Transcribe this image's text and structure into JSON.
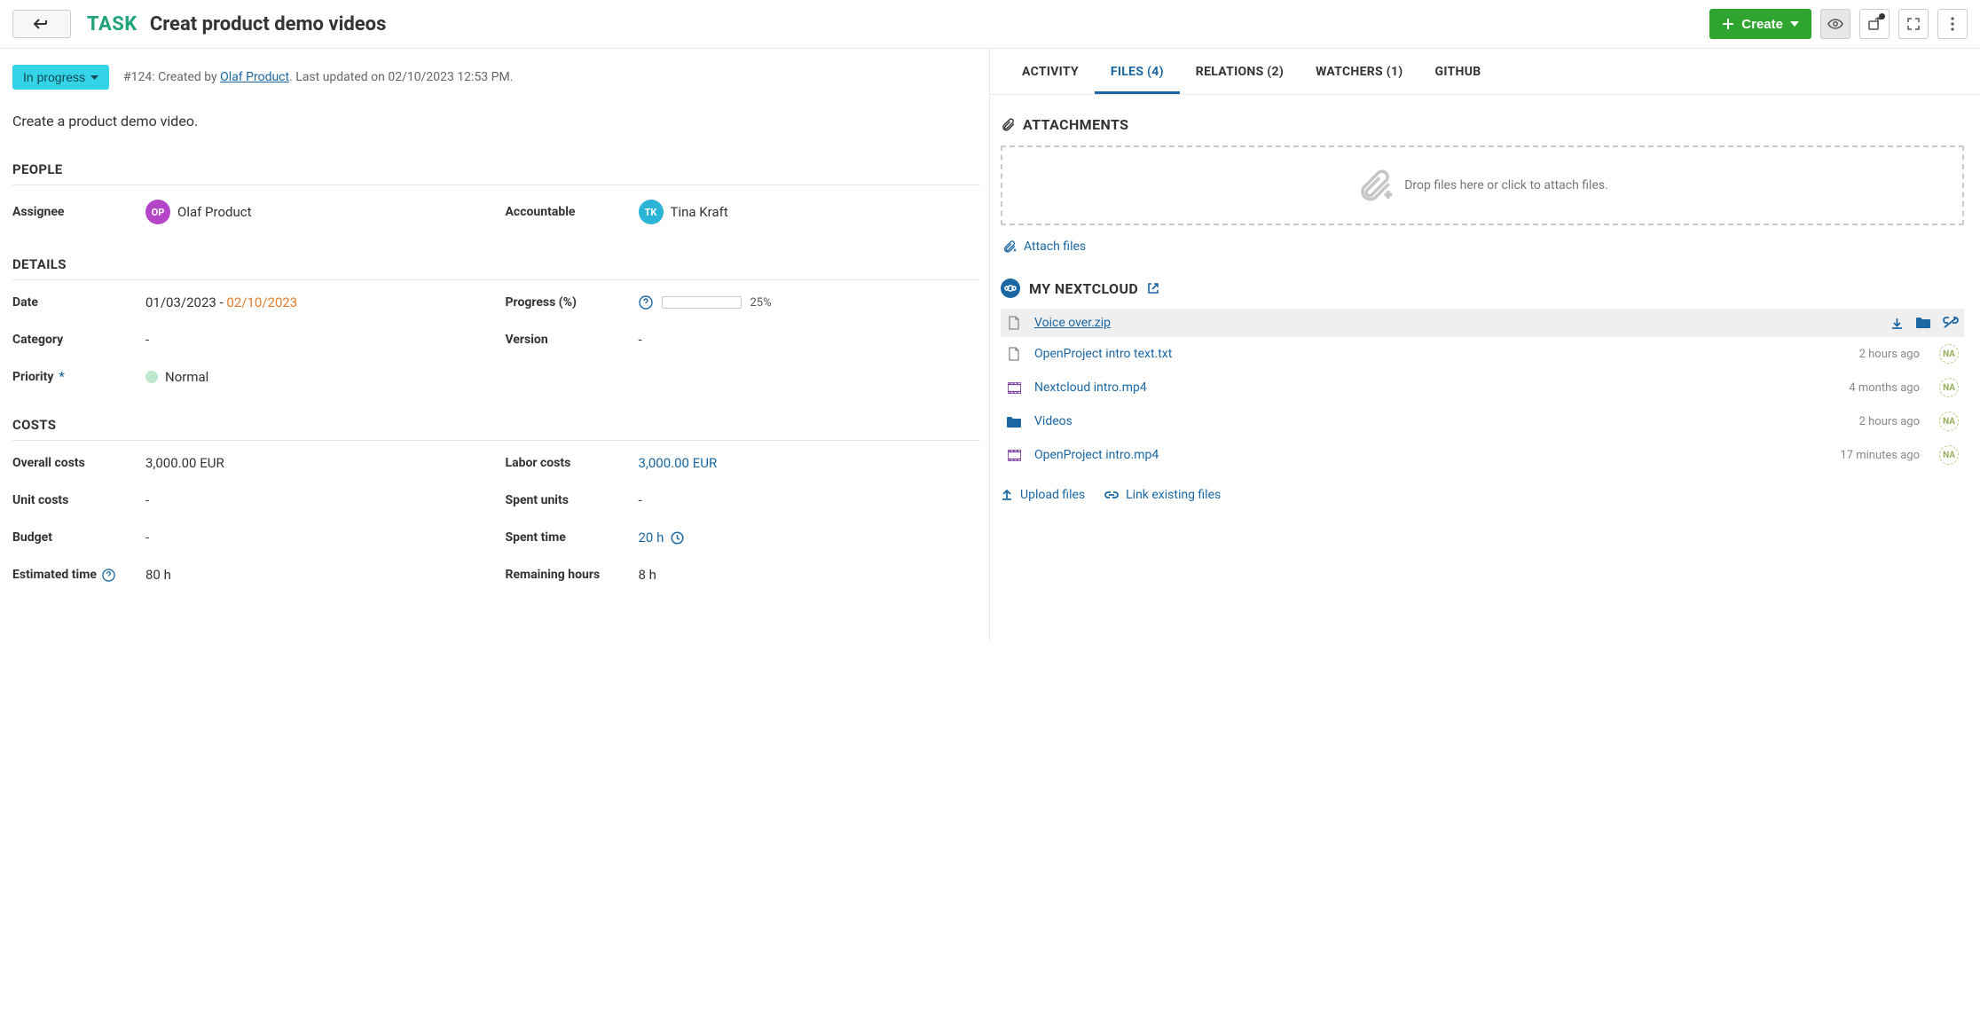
{
  "header": {
    "task_label": "TASK",
    "title": "Creat product demo videos",
    "create_label": "Create"
  },
  "status": {
    "state": "In progress",
    "meta_prefix": "#124: Created by ",
    "author": "Olaf Product",
    "meta_suffix": ". Last updated on 02/10/2023 12:53 PM."
  },
  "description": "Create a product demo video.",
  "people": {
    "heading": "PEOPLE",
    "assignee_label": "Assignee",
    "assignee_initials": "OP",
    "assignee_name": "Olaf Product",
    "accountable_label": "Accountable",
    "accountable_initials": "TK",
    "accountable_name": "Tina Kraft"
  },
  "details": {
    "heading": "DETAILS",
    "date_label": "Date",
    "date_start": "01/03/2023",
    "date_sep": " - ",
    "date_end": "02/10/2023",
    "progress_label": "Progress (%)",
    "progress_pct_num": 25,
    "progress_pct_text": "25%",
    "category_label": "Category",
    "category_value": "-",
    "version_label": "Version",
    "version_value": "-",
    "priority_label": "Priority",
    "priority_value": "Normal"
  },
  "costs": {
    "heading": "COSTS",
    "overall_label": "Overall costs",
    "overall_value": "3,000.00 EUR",
    "labor_label": "Labor costs",
    "labor_value": "3,000.00 EUR",
    "unit_label": "Unit costs",
    "unit_value": "-",
    "spent_units_label": "Spent units",
    "spent_units_value": "-",
    "budget_label": "Budget",
    "budget_value": "-",
    "spent_time_label": "Spent time",
    "spent_time_value": "20 h",
    "estimated_label": "Estimated time",
    "estimated_value": "80 h",
    "remaining_label": "Remaining hours",
    "remaining_value": "8 h"
  },
  "tabs": {
    "activity": "ACTIVITY",
    "files": "FILES (4)",
    "relations": "RELATIONS (2)",
    "watchers": "WATCHERS (1)",
    "github": "GITHUB"
  },
  "attachments": {
    "heading": "ATTACHMENTS",
    "drop_text": "Drop files here or click to attach files.",
    "attach_link": "Attach files"
  },
  "nextcloud": {
    "heading": "MY NEXTCLOUD",
    "files": [
      {
        "name": "Voice over.zip",
        "ago": "",
        "icon": "file",
        "highlight": true
      },
      {
        "name": "OpenProject intro text.txt",
        "ago": "2 hours ago",
        "icon": "file",
        "highlight": false
      },
      {
        "name": "Nextcloud intro.mp4",
        "ago": "4 months ago",
        "icon": "video",
        "highlight": false
      },
      {
        "name": "Videos",
        "ago": "2 hours ago",
        "icon": "folder",
        "highlight": false
      },
      {
        "name": "OpenProject intro.mp4",
        "ago": "17 minutes ago",
        "icon": "video",
        "highlight": false
      }
    ],
    "upload_link": "Upload files",
    "link_existing": "Link existing files",
    "na_initials": "NA"
  }
}
